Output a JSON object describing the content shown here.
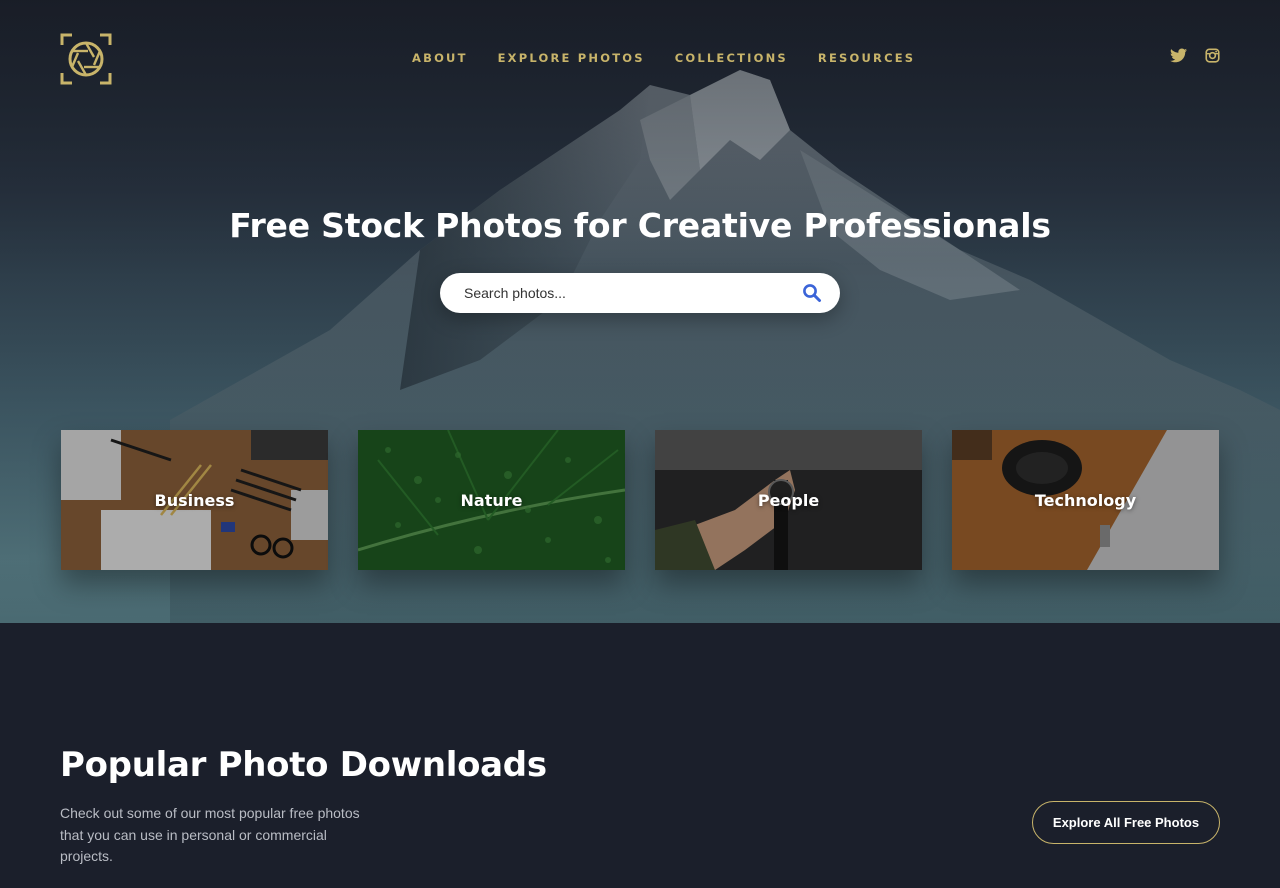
{
  "nav": {
    "items": [
      "ABOUT",
      "EXPLORE PHOTOS",
      "COLLECTIONS",
      "RESOURCES"
    ]
  },
  "social": [
    "twitter-icon",
    "instagram-icon"
  ],
  "hero": {
    "title": "Free Stock Photos for Creative Professionals",
    "search_placeholder": "Search photos..."
  },
  "categories": [
    "Business",
    "Nature",
    "People",
    "Technology"
  ],
  "popular": {
    "title": "Popular Photo Downloads",
    "description": "Check out some of our most popular free photos that you can use in personal or commercial projects.",
    "button_label": "Explore All Free Photos"
  },
  "colors": {
    "accent": "#c8b46a",
    "search_icon": "#3b64d8",
    "background": "#1b1f2b"
  }
}
